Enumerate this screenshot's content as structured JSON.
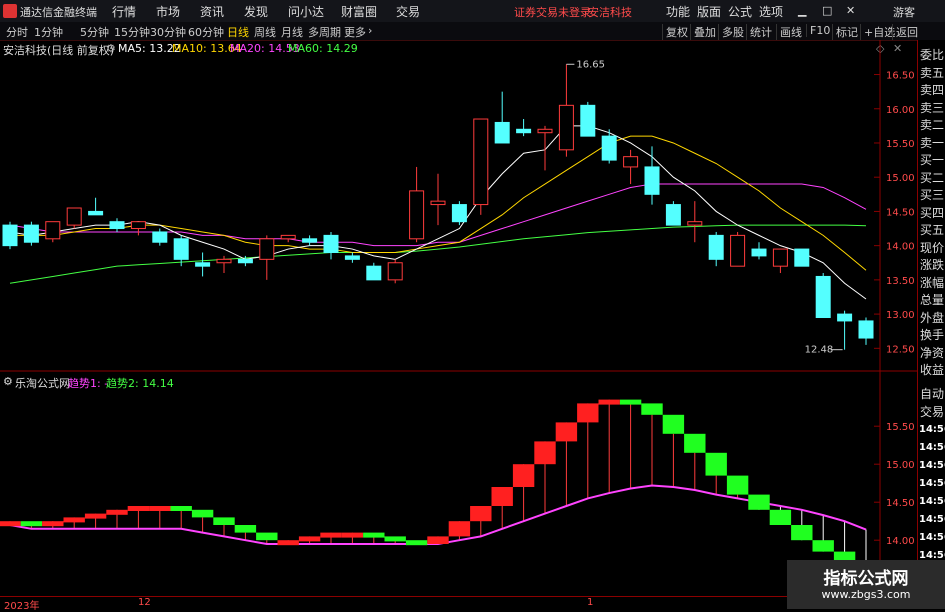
{
  "menubar": {
    "app_title": "通达信金融终端",
    "items": [
      "行情",
      "市场",
      "资讯",
      "发现",
      "问小达",
      "财富圈",
      "交易"
    ],
    "warning": "证券交易未登录",
    "stock_name": "安洁科技",
    "right_items": [
      "功能",
      "版面",
      "公式",
      "选项"
    ],
    "user": "游客"
  },
  "toolbar": {
    "periods": [
      "分时",
      "1分钟",
      "5分钟",
      "15分钟",
      "30分钟",
      "60分钟",
      "日线",
      "周线",
      "月线",
      "多周期",
      "更多"
    ],
    "active_period": "日线",
    "right_buttons": [
      "复权",
      "叠加",
      "多股",
      "统计",
      "画线",
      "F10",
      "标记",
      "+自选",
      "返回"
    ]
  },
  "main_chart": {
    "title": "安洁科技(日线 前复权)",
    "ma_labels": [
      {
        "text": "MA5: 13.22",
        "color": "#ffffff"
      },
      {
        "text": "MA10: 13.64",
        "color": "#ffd700"
      },
      {
        "text": "MA20: 14.53",
        "color": "#ff44ff"
      },
      {
        "text": "MA60: 14.29",
        "color": "#44ff44"
      }
    ],
    "high_label": "16.65",
    "low_label": "12.48",
    "y_ticks": [
      "16.50",
      "16.00",
      "15.50",
      "15.00",
      "14.50",
      "14.00",
      "13.50",
      "13.00",
      "12.50"
    ]
  },
  "indicator": {
    "title": "乐淘公式网",
    "line1": "趋势1: -",
    "line2": "趋势2: 14.14",
    "y_ticks": [
      "15.50",
      "15.00",
      "14.50",
      "14.00",
      "13.50"
    ]
  },
  "right_panel": {
    "items": [
      "委比",
      "卖五",
      "卖四",
      "卖三",
      "卖二",
      "卖一",
      "买一",
      "买二",
      "买三",
      "买四",
      "买五",
      "现价",
      "涨跌",
      "涨幅",
      "总量",
      "外盘",
      "换手",
      "净资",
      "收益"
    ],
    "tabs": [
      "自动",
      "交易"
    ],
    "times": [
      "14:56",
      "14:56",
      "14:56",
      "14:56",
      "14:56",
      "14:56",
      "14:56",
      "14:56"
    ]
  },
  "bottom_axis": {
    "dates": [
      "2023年",
      "12",
      "1"
    ]
  },
  "watermark": {
    "title": "指标公式网",
    "url": "www.zbgs3.com"
  },
  "chart_data": {
    "type": "candlestick",
    "ylim": [
      12.3,
      16.8
    ],
    "candles": [
      {
        "o": 14.3,
        "h": 14.35,
        "l": 13.95,
        "c": 14.0
      },
      {
        "o": 14.3,
        "h": 14.35,
        "l": 14.0,
        "c": 14.05
      },
      {
        "o": 14.1,
        "h": 14.35,
        "l": 14.05,
        "c": 14.35
      },
      {
        "o": 14.3,
        "h": 14.55,
        "l": 14.25,
        "c": 14.55
      },
      {
        "o": 14.5,
        "h": 14.7,
        "l": 14.45,
        "c": 14.45
      },
      {
        "o": 14.35,
        "h": 14.4,
        "l": 14.2,
        "c": 14.25
      },
      {
        "o": 14.25,
        "h": 14.35,
        "l": 14.15,
        "c": 14.35
      },
      {
        "o": 14.2,
        "h": 14.25,
        "l": 14.0,
        "c": 14.05
      },
      {
        "o": 14.1,
        "h": 14.15,
        "l": 13.7,
        "c": 13.8
      },
      {
        "o": 13.75,
        "h": 13.9,
        "l": 13.55,
        "c": 13.7
      },
      {
        "o": 13.75,
        "h": 13.85,
        "l": 13.6,
        "c": 13.8
      },
      {
        "o": 13.8,
        "h": 13.85,
        "l": 13.7,
        "c": 13.75
      },
      {
        "o": 13.8,
        "h": 14.15,
        "l": 13.5,
        "c": 14.1
      },
      {
        "o": 14.1,
        "h": 14.15,
        "l": 14.05,
        "c": 14.15
      },
      {
        "o": 14.1,
        "h": 14.15,
        "l": 14.0,
        "c": 14.05
      },
      {
        "o": 14.15,
        "h": 14.2,
        "l": 13.8,
        "c": 13.9
      },
      {
        "o": 13.85,
        "h": 13.9,
        "l": 13.75,
        "c": 13.8
      },
      {
        "o": 13.7,
        "h": 13.75,
        "l": 13.5,
        "c": 13.5
      },
      {
        "o": 13.5,
        "h": 13.8,
        "l": 13.45,
        "c": 13.75
      },
      {
        "o": 14.1,
        "h": 15.15,
        "l": 14.05,
        "c": 14.8
      },
      {
        "o": 14.6,
        "h": 15.05,
        "l": 14.3,
        "c": 14.65
      },
      {
        "o": 14.6,
        "h": 14.65,
        "l": 14.3,
        "c": 14.35
      },
      {
        "o": 14.6,
        "h": 15.65,
        "l": 14.45,
        "c": 15.85
      },
      {
        "o": 15.8,
        "h": 16.25,
        "l": 15.7,
        "c": 15.5
      },
      {
        "o": 15.7,
        "h": 15.85,
        "l": 15.6,
        "c": 15.65
      },
      {
        "o": 15.65,
        "h": 15.75,
        "l": 15.1,
        "c": 15.7
      },
      {
        "o": 15.4,
        "h": 16.65,
        "l": 15.3,
        "c": 16.05
      },
      {
        "o": 16.05,
        "h": 16.1,
        "l": 15.6,
        "c": 15.6
      },
      {
        "o": 15.6,
        "h": 15.7,
        "l": 15.2,
        "c": 15.25
      },
      {
        "o": 15.15,
        "h": 15.4,
        "l": 14.9,
        "c": 15.3
      },
      {
        "o": 15.15,
        "h": 15.45,
        "l": 14.6,
        "c": 14.75
      },
      {
        "o": 14.6,
        "h": 14.65,
        "l": 14.3,
        "c": 14.3
      },
      {
        "o": 14.3,
        "h": 14.65,
        "l": 14.05,
        "c": 14.35
      },
      {
        "o": 14.15,
        "h": 14.2,
        "l": 13.7,
        "c": 13.8
      },
      {
        "o": 13.7,
        "h": 14.2,
        "l": 13.7,
        "c": 14.15
      },
      {
        "o": 13.95,
        "h": 14.05,
        "l": 13.8,
        "c": 13.85
      },
      {
        "o": 13.7,
        "h": 13.95,
        "l": 13.6,
        "c": 13.95
      },
      {
        "o": 13.95,
        "h": 13.95,
        "l": 13.7,
        "c": 13.7
      },
      {
        "o": 13.55,
        "h": 13.6,
        "l": 12.95,
        "c": 12.95
      },
      {
        "o": 13.0,
        "h": 13.05,
        "l": 12.48,
        "c": 12.9
      },
      {
        "o": 12.9,
        "h": 12.95,
        "l": 12.55,
        "c": 12.65
      }
    ],
    "ma5": [
      14.2,
      14.15,
      14.2,
      14.25,
      14.3,
      14.3,
      14.35,
      14.3,
      14.15,
      14.05,
      13.95,
      13.8,
      13.85,
      13.95,
      14.0,
      14.0,
      13.95,
      13.85,
      13.8,
      13.95,
      14.1,
      14.25,
      14.7,
      15.05,
      15.35,
      15.4,
      15.75,
      15.75,
      15.65,
      15.5,
      15.3,
      15.0,
      14.8,
      14.5,
      14.3,
      14.15,
      14.0,
      13.9,
      13.75,
      13.45,
      13.22
    ],
    "ma10": [
      14.15,
      14.15,
      14.15,
      14.2,
      14.25,
      14.25,
      14.3,
      14.3,
      14.25,
      14.2,
      14.15,
      14.05,
      14.0,
      14.0,
      13.95,
      13.95,
      13.9,
      13.9,
      13.9,
      13.95,
      14.0,
      14.05,
      14.25,
      14.45,
      14.7,
      14.9,
      15.1,
      15.3,
      15.5,
      15.6,
      15.6,
      15.5,
      15.35,
      15.2,
      15.0,
      14.8,
      14.55,
      14.35,
      14.15,
      13.9,
      13.64
    ],
    "ma20": [
      14.3,
      14.25,
      14.2,
      14.2,
      14.2,
      14.2,
      14.2,
      14.2,
      14.2,
      14.15,
      14.15,
      14.1,
      14.1,
      14.1,
      14.05,
      14.05,
      14.05,
      14.0,
      14.0,
      14.0,
      14.05,
      14.05,
      14.15,
      14.25,
      14.35,
      14.45,
      14.55,
      14.65,
      14.75,
      14.85,
      14.9,
      14.9,
      14.9,
      14.9,
      14.9,
      14.9,
      14.9,
      14.9,
      14.85,
      14.7,
      14.53
    ],
    "ma60": [
      13.45,
      13.5,
      13.55,
      13.6,
      13.65,
      13.7,
      13.72,
      13.74,
      13.76,
      13.78,
      13.8,
      13.82,
      13.84,
      13.86,
      13.88,
      13.9,
      13.9,
      13.9,
      13.9,
      13.92,
      13.95,
      13.98,
      14.02,
      14.06,
      14.1,
      14.13,
      14.16,
      14.19,
      14.21,
      14.23,
      14.25,
      14.27,
      14.28,
      14.29,
      14.3,
      14.3,
      14.3,
      14.3,
      14.3,
      14.3,
      14.29
    ],
    "indicator": {
      "ylim": [
        13.45,
        15.95
      ],
      "trend1": [
        14.25,
        14.2,
        14.25,
        14.3,
        14.35,
        14.4,
        14.45,
        14.45,
        14.4,
        14.3,
        14.2,
        14.1,
        14.0,
        14.0,
        14.05,
        14.1,
        14.1,
        14.05,
        14.0,
        13.95,
        14.05,
        14.25,
        14.45,
        14.7,
        15.0,
        15.3,
        15.55,
        15.8,
        15.85,
        15.8,
        15.65,
        15.4,
        15.15,
        14.85,
        14.6,
        14.4,
        14.2,
        14.0,
        13.85,
        13.7,
        13.55
      ],
      "trend2": [
        14.2,
        14.15,
        14.15,
        14.15,
        14.15,
        14.15,
        14.15,
        14.15,
        14.15,
        14.1,
        14.05,
        14.0,
        13.95,
        13.95,
        13.95,
        13.95,
        13.95,
        13.95,
        13.95,
        13.95,
        13.95,
        14.0,
        14.05,
        14.15,
        14.25,
        14.35,
        14.45,
        14.55,
        14.62,
        14.68,
        14.72,
        14.7,
        14.66,
        14.6,
        14.55,
        14.5,
        14.45,
        14.4,
        14.33,
        14.25,
        14.14
      ]
    }
  }
}
